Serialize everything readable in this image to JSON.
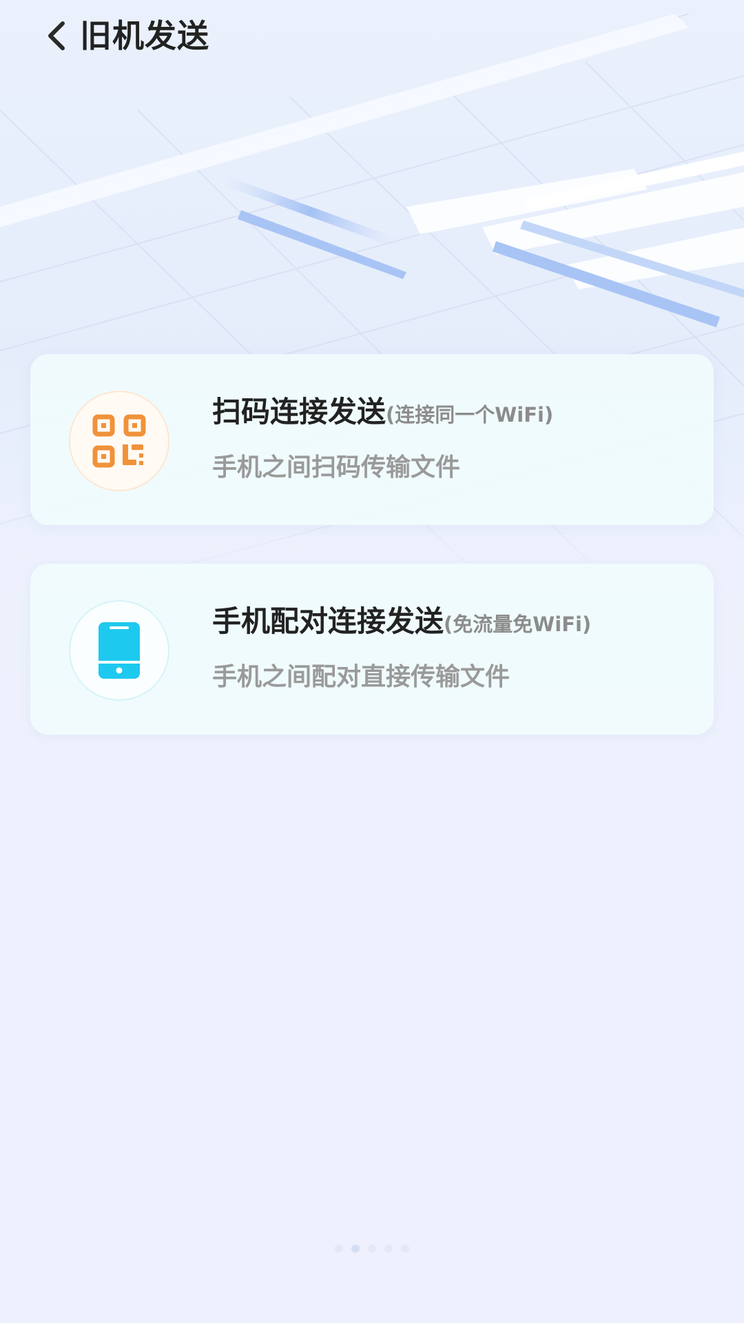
{
  "header": {
    "back_icon": "chevron-left-icon",
    "title": "旧机发送"
  },
  "options": [
    {
      "title": "扫码连接发送",
      "note": "(连接同一个WiFi)",
      "subtitle": "手机之间扫码传输文件",
      "icon": "qr-code-icon",
      "icon_color": "#f0923a"
    },
    {
      "title": "手机配对连接发送",
      "note": "(免流量免WiFi)",
      "subtitle": "手机之间配对直接传输文件",
      "icon": "phone-icon",
      "icon_color": "#1ec9ef"
    }
  ],
  "page_indicator": {
    "count": 5,
    "active_index": 1
  },
  "colors": {
    "title_text": "#222222",
    "note_text": "#8c8c8c",
    "subtitle_text": "#9a9a9a",
    "card_background": "#f0fbfd"
  }
}
